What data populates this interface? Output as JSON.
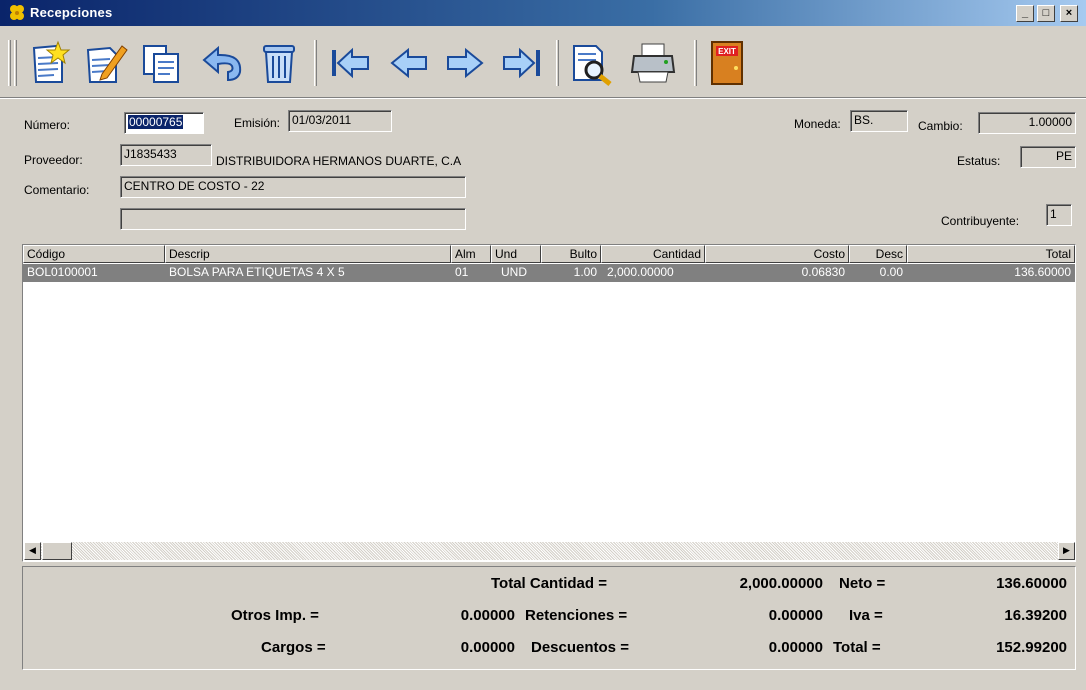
{
  "window": {
    "title": "Recepciones",
    "min": "_",
    "max": "□",
    "close": "×"
  },
  "toolbar": {
    "icons": [
      "new-document-icon",
      "edit-document-icon",
      "copy-documents-icon",
      "undo-icon",
      "trash-can-icon",
      "first-record-icon",
      "previous-record-icon",
      "next-record-icon",
      "last-record-icon",
      "search-document-icon",
      "printer-icon",
      "exit-door-icon"
    ],
    "exit_label": "EXIT"
  },
  "form": {
    "numero_label": "Número:",
    "numero": "00000765",
    "emision_label": "Emisión:",
    "emision": "01/03/2011",
    "moneda_label": "Moneda:",
    "moneda": "BS.",
    "cambio_label": "Cambio:",
    "cambio": "1.00000",
    "proveedor_label": "Proveedor:",
    "proveedor_codigo": "J1835433",
    "proveedor_nombre": "DISTRIBUIDORA HERMANOS DUARTE, C.A",
    "estatus_label": "Estatus:",
    "estatus": "PE",
    "comentario_label": "Comentario:",
    "comentario1": "CENTRO DE COSTO - 22",
    "comentario2": "",
    "contribuyente_label": "Contribuyente:",
    "contribuyente": "1"
  },
  "grid": {
    "headers": [
      "Código",
      "Descrip",
      "Alm",
      "Und",
      "Bulto",
      "Cantidad",
      "Costo",
      "Desc",
      "Total"
    ],
    "rows": [
      [
        "BOL0100001",
        "BOLSA PARA ETIQUETAS 4 X 5",
        "01",
        "UND",
        "1.00",
        "2,000.00000",
        "0.06830",
        "0.00",
        "136.60000"
      ]
    ],
    "scroll_left": "◀",
    "scroll_right": "▶"
  },
  "totals": {
    "total_cantidad_label": "Total Cantidad =",
    "total_cantidad": "2,000.00000",
    "neto_label": "Neto =",
    "neto": "136.60000",
    "otros_imp_label": "Otros Imp. =",
    "otros_imp": "0.00000",
    "retenciones_label": "Retenciones =",
    "retenciones": "0.00000",
    "iva_label": "Iva =",
    "iva": "16.39200",
    "cargos_label": "Cargos =",
    "cargos": "0.00000",
    "descuentos_label": "Descuentos =",
    "descuentos": "0.00000",
    "total_label": "Total =",
    "total": "152.99200"
  }
}
